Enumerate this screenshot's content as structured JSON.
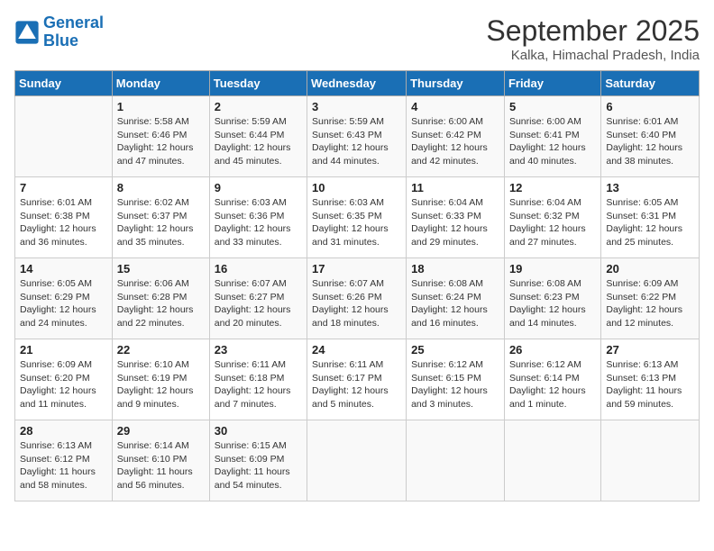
{
  "header": {
    "logo_line1": "General",
    "logo_line2": "Blue",
    "month": "September 2025",
    "location": "Kalka, Himachal Pradesh, India"
  },
  "days_of_week": [
    "Sunday",
    "Monday",
    "Tuesday",
    "Wednesday",
    "Thursday",
    "Friday",
    "Saturday"
  ],
  "weeks": [
    [
      {
        "num": "",
        "info": ""
      },
      {
        "num": "1",
        "info": "Sunrise: 5:58 AM\nSunset: 6:46 PM\nDaylight: 12 hours\nand 47 minutes."
      },
      {
        "num": "2",
        "info": "Sunrise: 5:59 AM\nSunset: 6:44 PM\nDaylight: 12 hours\nand 45 minutes."
      },
      {
        "num": "3",
        "info": "Sunrise: 5:59 AM\nSunset: 6:43 PM\nDaylight: 12 hours\nand 44 minutes."
      },
      {
        "num": "4",
        "info": "Sunrise: 6:00 AM\nSunset: 6:42 PM\nDaylight: 12 hours\nand 42 minutes."
      },
      {
        "num": "5",
        "info": "Sunrise: 6:00 AM\nSunset: 6:41 PM\nDaylight: 12 hours\nand 40 minutes."
      },
      {
        "num": "6",
        "info": "Sunrise: 6:01 AM\nSunset: 6:40 PM\nDaylight: 12 hours\nand 38 minutes."
      }
    ],
    [
      {
        "num": "7",
        "info": "Sunrise: 6:01 AM\nSunset: 6:38 PM\nDaylight: 12 hours\nand 36 minutes."
      },
      {
        "num": "8",
        "info": "Sunrise: 6:02 AM\nSunset: 6:37 PM\nDaylight: 12 hours\nand 35 minutes."
      },
      {
        "num": "9",
        "info": "Sunrise: 6:03 AM\nSunset: 6:36 PM\nDaylight: 12 hours\nand 33 minutes."
      },
      {
        "num": "10",
        "info": "Sunrise: 6:03 AM\nSunset: 6:35 PM\nDaylight: 12 hours\nand 31 minutes."
      },
      {
        "num": "11",
        "info": "Sunrise: 6:04 AM\nSunset: 6:33 PM\nDaylight: 12 hours\nand 29 minutes."
      },
      {
        "num": "12",
        "info": "Sunrise: 6:04 AM\nSunset: 6:32 PM\nDaylight: 12 hours\nand 27 minutes."
      },
      {
        "num": "13",
        "info": "Sunrise: 6:05 AM\nSunset: 6:31 PM\nDaylight: 12 hours\nand 25 minutes."
      }
    ],
    [
      {
        "num": "14",
        "info": "Sunrise: 6:05 AM\nSunset: 6:29 PM\nDaylight: 12 hours\nand 24 minutes."
      },
      {
        "num": "15",
        "info": "Sunrise: 6:06 AM\nSunset: 6:28 PM\nDaylight: 12 hours\nand 22 minutes."
      },
      {
        "num": "16",
        "info": "Sunrise: 6:07 AM\nSunset: 6:27 PM\nDaylight: 12 hours\nand 20 minutes."
      },
      {
        "num": "17",
        "info": "Sunrise: 6:07 AM\nSunset: 6:26 PM\nDaylight: 12 hours\nand 18 minutes."
      },
      {
        "num": "18",
        "info": "Sunrise: 6:08 AM\nSunset: 6:24 PM\nDaylight: 12 hours\nand 16 minutes."
      },
      {
        "num": "19",
        "info": "Sunrise: 6:08 AM\nSunset: 6:23 PM\nDaylight: 12 hours\nand 14 minutes."
      },
      {
        "num": "20",
        "info": "Sunrise: 6:09 AM\nSunset: 6:22 PM\nDaylight: 12 hours\nand 12 minutes."
      }
    ],
    [
      {
        "num": "21",
        "info": "Sunrise: 6:09 AM\nSunset: 6:20 PM\nDaylight: 12 hours\nand 11 minutes."
      },
      {
        "num": "22",
        "info": "Sunrise: 6:10 AM\nSunset: 6:19 PM\nDaylight: 12 hours\nand 9 minutes."
      },
      {
        "num": "23",
        "info": "Sunrise: 6:11 AM\nSunset: 6:18 PM\nDaylight: 12 hours\nand 7 minutes."
      },
      {
        "num": "24",
        "info": "Sunrise: 6:11 AM\nSunset: 6:17 PM\nDaylight: 12 hours\nand 5 minutes."
      },
      {
        "num": "25",
        "info": "Sunrise: 6:12 AM\nSunset: 6:15 PM\nDaylight: 12 hours\nand 3 minutes."
      },
      {
        "num": "26",
        "info": "Sunrise: 6:12 AM\nSunset: 6:14 PM\nDaylight: 12 hours\nand 1 minute."
      },
      {
        "num": "27",
        "info": "Sunrise: 6:13 AM\nSunset: 6:13 PM\nDaylight: 11 hours\nand 59 minutes."
      }
    ],
    [
      {
        "num": "28",
        "info": "Sunrise: 6:13 AM\nSunset: 6:12 PM\nDaylight: 11 hours\nand 58 minutes."
      },
      {
        "num": "29",
        "info": "Sunrise: 6:14 AM\nSunset: 6:10 PM\nDaylight: 11 hours\nand 56 minutes."
      },
      {
        "num": "30",
        "info": "Sunrise: 6:15 AM\nSunset: 6:09 PM\nDaylight: 11 hours\nand 54 minutes."
      },
      {
        "num": "",
        "info": ""
      },
      {
        "num": "",
        "info": ""
      },
      {
        "num": "",
        "info": ""
      },
      {
        "num": "",
        "info": ""
      }
    ]
  ]
}
